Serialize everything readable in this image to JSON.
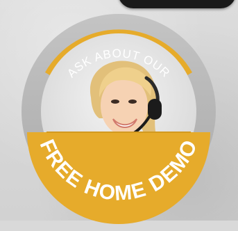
{
  "badge": {
    "top_text": "ASK ABOUT OUR",
    "bottom_text": "FREE HOME DEMO",
    "colors": {
      "ring_gray": "#b3b3b3",
      "ring_gold": "#e6ab2b",
      "inner_bg": "#ececec",
      "text": "#ffffff"
    },
    "image": {
      "subject": "woman-with-headset",
      "icon": "headset-icon"
    }
  }
}
